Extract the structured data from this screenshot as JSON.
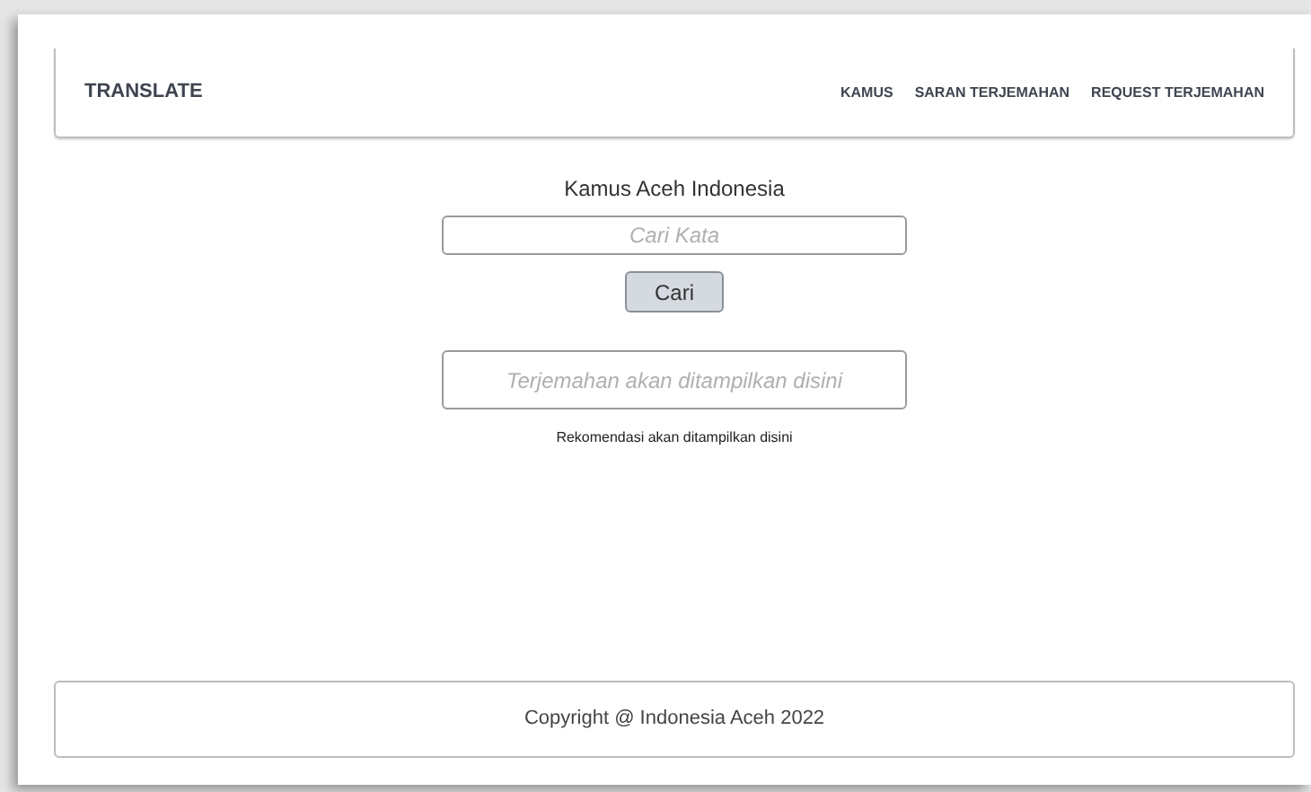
{
  "header": {
    "brand": "TRANSLATE",
    "nav": [
      {
        "label": "KAMUS"
      },
      {
        "label": "SARAN TERJEMAHAN"
      },
      {
        "label": "REQUEST TERJEMAHAN"
      }
    ]
  },
  "main": {
    "title": "Kamus Aceh Indonesia",
    "search": {
      "placeholder": "Cari Kata"
    },
    "button": "Cari",
    "output": {
      "placeholder": "Terjemahan akan ditampilkan disini"
    },
    "recommendation": "Rekomendasi akan ditampilkan disini"
  },
  "footer": {
    "text": "Copyright @ Indonesia Aceh 2022"
  }
}
